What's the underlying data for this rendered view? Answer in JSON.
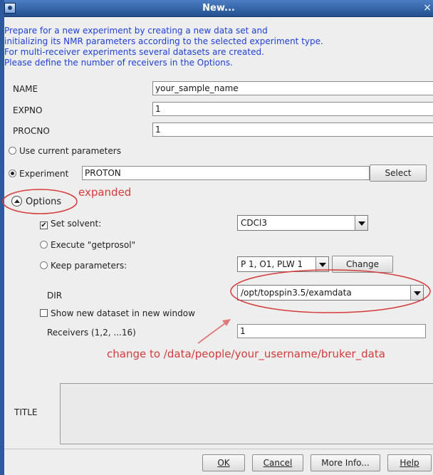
{
  "window": {
    "title": "New...",
    "close_glyph": "×"
  },
  "intro_lines": [
    "Prepare for a new experiment by creating a new data set and",
    "initializing its NMR parameters according to the selected experiment type.",
    "For multi-receiver experiments several datasets are created.",
    "Please define the number of receivers in the Options."
  ],
  "fields": {
    "name": {
      "label": "NAME",
      "value": "your_sample_name"
    },
    "expno": {
      "label": "EXPNO",
      "value": "1"
    },
    "procno": {
      "label": "PROCNO",
      "value": "1"
    }
  },
  "params": {
    "use_current_label": "Use current parameters",
    "experiment_label": "Experiment",
    "experiment_value": "PROTON",
    "select_button": "Select",
    "selected": "experiment"
  },
  "options": {
    "label": "Options",
    "set_solvent": {
      "label": "Set solvent:",
      "checked": true,
      "check_glyph": "✔",
      "value": "CDCl3"
    },
    "execute_getprosol": {
      "label": "Execute \"getprosol\""
    },
    "keep_parameters": {
      "label": "Keep parameters:",
      "value": "P 1, O1, PLW 1",
      "change_button": "Change"
    },
    "dir": {
      "label": "DIR",
      "value": "/opt/topspin3.5/examdata"
    },
    "show_new_window": {
      "label": "Show new dataset in new window",
      "checked": false
    },
    "receivers": {
      "label": "Receivers (1,2, ...16)",
      "value": "1"
    }
  },
  "title_field": {
    "label": "TITLE",
    "value": ""
  },
  "buttons": {
    "ok": "OK",
    "cancel": "Cancel",
    "more_info": "More Info...",
    "help": "Help"
  },
  "annotations": {
    "expanded": "expanded",
    "change_to": "change to /data/people/your_username/bruker_data",
    "color": "#d63a3a"
  },
  "colors": {
    "titlebar": "#2d5a9e",
    "intro_text": "#1f40d8"
  }
}
